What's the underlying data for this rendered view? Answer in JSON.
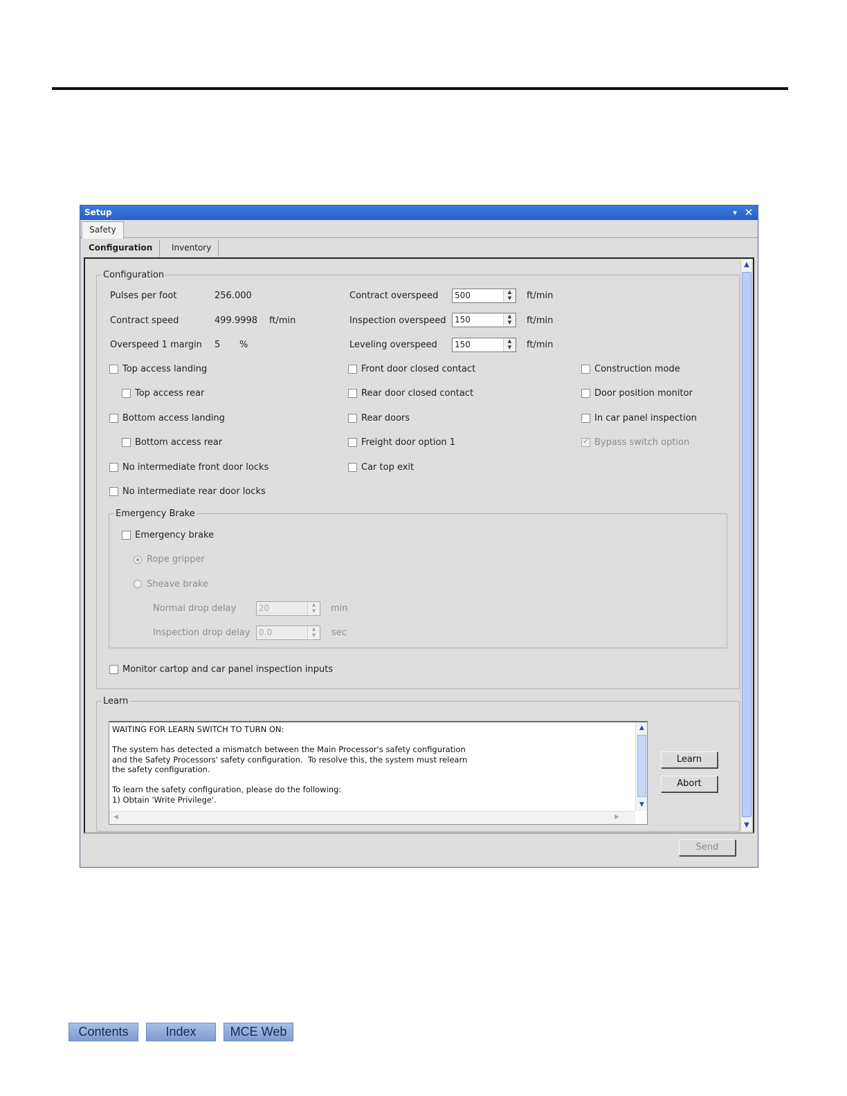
{
  "window": {
    "title": "Setup",
    "menu_glyph": "▾",
    "close_glyph": "✕"
  },
  "outer_tabs": [
    "Safety"
  ],
  "inner_tabs": [
    "Configuration",
    "Inventory"
  ],
  "configuration": {
    "legend": "Configuration",
    "pulses_per_foot": {
      "label": "Pulses per foot",
      "value": "256.000"
    },
    "contract_speed": {
      "label": "Contract speed",
      "value": "499.9998",
      "unit": "ft/min"
    },
    "overspeed_margin": {
      "label": "Overspeed 1 margin",
      "value": "5",
      "unit": "%"
    },
    "contract_overspeed": {
      "label": "Contract overspeed",
      "value": "500",
      "unit": "ft/min"
    },
    "inspection_overspeed": {
      "label": "Inspection overspeed",
      "value": "150",
      "unit": "ft/min"
    },
    "leveling_overspeed": {
      "label": "Leveling overspeed",
      "value": "150",
      "unit": "ft/min"
    },
    "checkboxes": {
      "top_access_landing": {
        "label": "Top access landing",
        "checked": false
      },
      "top_access_rear": {
        "label": "Top access rear",
        "checked": false
      },
      "bottom_access_landing": {
        "label": "Bottom access landing",
        "checked": false
      },
      "bottom_access_rear": {
        "label": "Bottom access rear",
        "checked": false
      },
      "no_int_front": {
        "label": "No intermediate front door locks",
        "checked": false
      },
      "no_int_rear": {
        "label": "No intermediate rear door locks",
        "checked": false
      },
      "front_door_closed": {
        "label": "Front door closed contact",
        "checked": false
      },
      "rear_door_closed": {
        "label": "Rear door closed contact",
        "checked": false
      },
      "rear_doors": {
        "label": "Rear doors",
        "checked": false
      },
      "freight_door": {
        "label": "Freight door option 1",
        "checked": false
      },
      "car_top_exit": {
        "label": "Car top exit",
        "checked": false
      },
      "construction_mode": {
        "label": "Construction mode",
        "checked": false
      },
      "door_position_monitor": {
        "label": "Door position monitor",
        "checked": false
      },
      "in_car_panel_inspection": {
        "label": "In car panel inspection",
        "checked": false
      },
      "bypass_switch_option": {
        "label": "Bypass switch option",
        "checked": true,
        "disabled": true
      },
      "monitor_cartop": {
        "label": "Monitor cartop and car panel inspection inputs",
        "checked": false
      }
    },
    "emergency_brake": {
      "legend": "Emergency Brake",
      "enable_label": "Emergency brake",
      "rope_gripper": "Rope gripper",
      "sheave_brake": "Sheave brake",
      "normal_drop_delay": {
        "label": "Normal drop delay",
        "value": "20",
        "unit": "min"
      },
      "inspection_drop_delay": {
        "label": "Inspection drop delay",
        "value": "0.0",
        "unit": "sec"
      }
    }
  },
  "learn": {
    "legend": "Learn",
    "log_text": "WAITING FOR LEARN SWITCH TO TURN ON:\n\nThe system has detected a mismatch between the Main Processor's safety configuration\nand the Safety Processors' safety configuration.  To resolve this, the system must relearn\nthe safety configuration.\n\nTo learn the safety configuration, please do the following:\n1) Obtain 'Write Privilege'.",
    "learn_button": "Learn",
    "abort_button": "Abort"
  },
  "send_button": "Send",
  "nav": {
    "contents": "Contents",
    "index": "Index",
    "web": "MCE Web"
  }
}
